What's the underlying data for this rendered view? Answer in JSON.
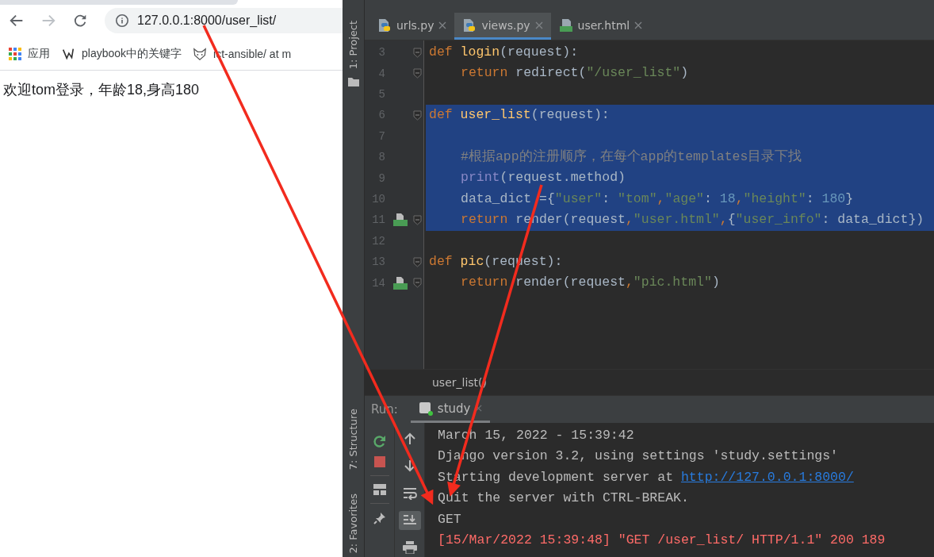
{
  "browser": {
    "address": "127.0.0.1:8000/user_list/",
    "bookmarks": [
      {
        "label": "应用"
      },
      {
        "label": "playbook中的关键字"
      },
      {
        "label": "ict-ansible/ at m"
      }
    ],
    "page_text": "欢迎tom登录，年龄18,身高180"
  },
  "ide": {
    "side_tools_top": [
      "1: Project"
    ],
    "side_tools_bottom": [
      "7: Structure",
      "2: Favorites"
    ],
    "tabs": [
      {
        "label": "urls.py",
        "kind": "python",
        "selected": false
      },
      {
        "label": "views.py",
        "kind": "python",
        "selected": true
      },
      {
        "label": "user.html",
        "kind": "html",
        "selected": false
      }
    ],
    "editor": {
      "lines": [
        {
          "number": "3",
          "selected": false,
          "indented": false,
          "fold": true,
          "template_marker": false,
          "tokens": [
            {
              "kind": "keyword",
              "text": "def "
            },
            {
              "kind": "function",
              "text": "login"
            },
            {
              "kind": "plain",
              "text": "(request):"
            }
          ]
        },
        {
          "number": "4",
          "selected": false,
          "indented": true,
          "fold": true,
          "template_marker": false,
          "tokens": [
            {
              "kind": "keyword",
              "text": "return "
            },
            {
              "kind": "plain",
              "text": "redirect("
            },
            {
              "kind": "string",
              "text": "\"/user_list\""
            },
            {
              "kind": "plain",
              "text": ")"
            }
          ]
        },
        {
          "number": "5",
          "selected": false,
          "fold": false,
          "template_marker": false
        },
        {
          "number": "6",
          "selected": true,
          "indented": false,
          "fold": true,
          "template_marker": false,
          "tokens": [
            {
              "kind": "keyword",
              "text": "def "
            },
            {
              "kind": "function",
              "text": "user_list"
            },
            {
              "kind": "plain",
              "text": "(request):"
            }
          ]
        },
        {
          "number": "7",
          "selected": true,
          "fold": false,
          "template_marker": false
        },
        {
          "number": "8",
          "selected": true,
          "indented": true,
          "fold": false,
          "template_marker": false,
          "tokens": [
            {
              "kind": "comment",
              "text": "#根据app的注册顺序，在每个app的templates目录下找"
            }
          ]
        },
        {
          "number": "9",
          "selected": true,
          "indented": true,
          "fold": false,
          "template_marker": false,
          "tokens": [
            {
              "kind": "builtin",
              "text": "print"
            },
            {
              "kind": "plain",
              "text": "(request.method)"
            }
          ]
        },
        {
          "number": "10",
          "selected": true,
          "indented": true,
          "fold": false,
          "template_marker": false,
          "tokens": [
            {
              "kind": "plain",
              "text": "data_dict ={"
            },
            {
              "kind": "string",
              "text": "\"user\""
            },
            {
              "kind": "plain",
              "text": ": "
            },
            {
              "kind": "string",
              "text": "\"tom\""
            },
            {
              "kind": "keyword",
              "text": ","
            },
            {
              "kind": "string",
              "text": "\"age\""
            },
            {
              "kind": "plain",
              "text": ": "
            },
            {
              "kind": "number",
              "text": "18"
            },
            {
              "kind": "keyword",
              "text": ","
            },
            {
              "kind": "string",
              "text": "\"height\""
            },
            {
              "kind": "plain",
              "text": ": "
            },
            {
              "kind": "number",
              "text": "180"
            },
            {
              "kind": "plain",
              "text": "}"
            }
          ]
        },
        {
          "number": "11",
          "selected": true,
          "indented": true,
          "fold": true,
          "template_marker": true,
          "tokens": [
            {
              "kind": "keyword",
              "text": "return "
            },
            {
              "kind": "plain",
              "text": "render(request"
            },
            {
              "kind": "keyword",
              "text": ","
            },
            {
              "kind": "string",
              "text": "\"user.html\""
            },
            {
              "kind": "keyword",
              "text": ","
            },
            {
              "kind": "plain",
              "text": "{"
            },
            {
              "kind": "string",
              "text": "\"user_info\""
            },
            {
              "kind": "plain",
              "text": ": data_dict})"
            }
          ]
        },
        {
          "number": "12",
          "selected": false,
          "fold": false,
          "template_marker": false
        },
        {
          "number": "13",
          "selected": false,
          "indented": false,
          "fold": true,
          "template_marker": false,
          "tokens": [
            {
              "kind": "keyword",
              "text": "def "
            },
            {
              "kind": "function",
              "text": "pic"
            },
            {
              "kind": "plain",
              "text": "(request):"
            }
          ]
        },
        {
          "number": "14",
          "selected": false,
          "indented": true,
          "fold": true,
          "template_marker": true,
          "tokens": [
            {
              "kind": "keyword",
              "text": "return "
            },
            {
              "kind": "plain",
              "text": "render(request"
            },
            {
              "kind": "keyword",
              "text": ","
            },
            {
              "kind": "string",
              "text": "\"pic.html\""
            },
            {
              "kind": "plain",
              "text": ")"
            }
          ]
        }
      ]
    },
    "breadcrumb": "user_list()",
    "run": {
      "label": "Run:",
      "tabs": [
        {
          "label": "study",
          "selected": true
        }
      ],
      "tools": [
        {
          "on": false
        },
        {
          "on": false
        },
        {
          "on": false
        },
        {
          "on": true
        },
        {
          "on": false
        }
      ],
      "console": [
        {
          "kind": "normal",
          "tokens": [
            {
              "kind": "plain",
              "text": "March 15, 2022 - 15:39:42"
            }
          ]
        },
        {
          "kind": "normal",
          "tokens": [
            {
              "kind": "plain",
              "text": "Django version 3.2, using settings 'study.settings'"
            }
          ]
        },
        {
          "kind": "normal",
          "tokens": [
            {
              "kind": "plain",
              "text": "Starting development server at "
            },
            {
              "kind": "link",
              "text": "http://127.0.0.1:8000/"
            }
          ]
        },
        {
          "kind": "normal",
          "tokens": [
            {
              "kind": "plain",
              "text": "Quit the server with CTRL-BREAK."
            }
          ]
        },
        {
          "kind": "normal",
          "tokens": [
            {
              "kind": "plain",
              "text": "GET"
            }
          ]
        },
        {
          "kind": "request",
          "tokens": [
            {
              "kind": "plain",
              "text": "[15/Mar/2022 15:39:48] \"GET /user_list/ HTTP/1.1\" 200 189"
            }
          ]
        }
      ]
    }
  }
}
